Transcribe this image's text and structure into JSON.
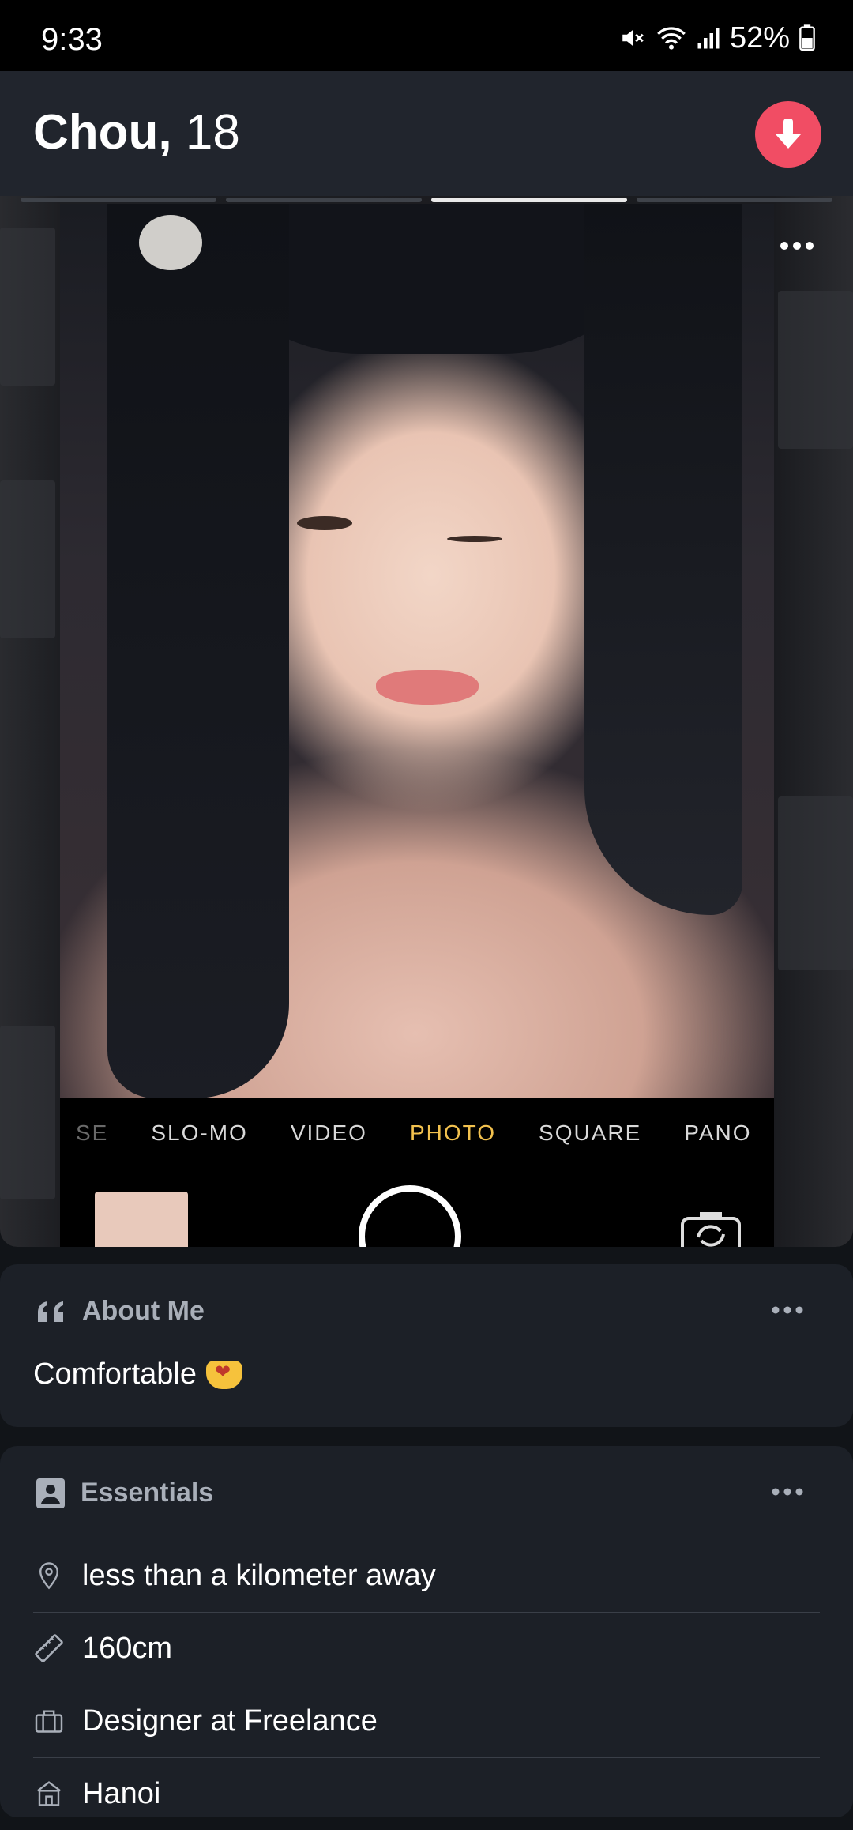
{
  "status_bar": {
    "time": "9:33",
    "battery": "52%"
  },
  "header": {
    "name": "Chou,",
    "age": "18"
  },
  "camera": {
    "modes": [
      "SE",
      "SLO-MO",
      "VIDEO",
      "PHOTO",
      "SQUARE",
      "PANO"
    ],
    "active_mode": "PHOTO"
  },
  "about": {
    "title": "About Me",
    "text": "Comfortable"
  },
  "essentials": {
    "title": "Essentials",
    "items": [
      {
        "icon": "location-pin-icon",
        "text": "less than a kilometer away"
      },
      {
        "icon": "ruler-icon",
        "text": "160cm"
      },
      {
        "icon": "briefcase-icon",
        "text": "Designer at Freelance"
      },
      {
        "icon": "building-icon",
        "text": "Hanoi"
      }
    ]
  },
  "colors": {
    "accent": "#f14d64",
    "camera_active": "#f2c14e",
    "card_bg": "#1c2027"
  }
}
